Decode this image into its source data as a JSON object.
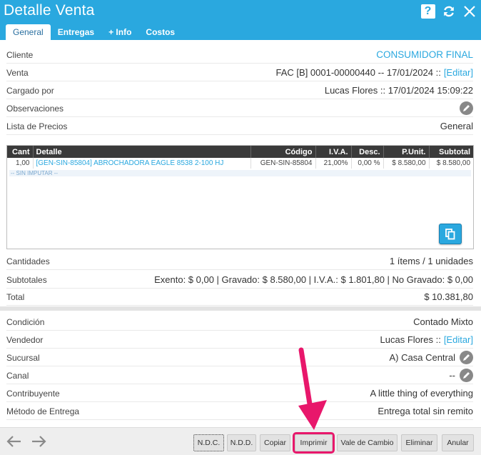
{
  "window": {
    "title": "Detalle Venta"
  },
  "tabs": [
    {
      "label": "General",
      "active": true
    },
    {
      "label": "Entregas",
      "active": false
    },
    {
      "label": "+ Info",
      "active": false
    },
    {
      "label": "Costos",
      "active": false
    }
  ],
  "fields": {
    "cliente": {
      "label": "Cliente",
      "value": "CONSUMIDOR FINAL"
    },
    "venta": {
      "label": "Venta",
      "value": "FAC [B] 0001-00000440 -- 17/01/2024 ::",
      "link": "[Editar]"
    },
    "cargado": {
      "label": "Cargado por",
      "value": "Lucas Flores :: 17/01/2024 15:09:22"
    },
    "observaciones": {
      "label": "Observaciones"
    },
    "lista": {
      "label": "Lista de Precios",
      "value": "General"
    }
  },
  "table": {
    "headers": [
      "Cant",
      "Detalle",
      "Código",
      "I.V.A.",
      "Desc.",
      "P.Unit.",
      "Subtotal"
    ],
    "rows": [
      {
        "cant": "1,00",
        "detalle": "[GEN-SIN-85804] ABROCHADORA EAGLE 8538 2-100 HJ",
        "codigo": "GEN-SIN-85804",
        "iva": "21,00%",
        "desc": "0,00 %",
        "punit": "$ 8.580,00",
        "subtotal": "$ 8.580,00"
      }
    ],
    "sin_imputar": "-- SIN IMPUTAR --"
  },
  "totals": {
    "cantidades": {
      "label": "Cantidades",
      "value": "1 ítems / 1 unidades"
    },
    "subtotales": {
      "label": "Subtotales",
      "value": "Exento: $ 0,00 | Gravado: $ 8.580,00 | I.V.A.: $ 1.801,80 | No Gravado: $ 0,00"
    },
    "total": {
      "label": "Total",
      "value": "$ 10.381,80"
    }
  },
  "details": {
    "condicion": {
      "label": "Condición",
      "value": "Contado Mixto"
    },
    "vendedor": {
      "label": "Vendedor",
      "value": "Lucas Flores ::",
      "link": "[Editar]"
    },
    "sucursal": {
      "label": "Sucursal",
      "value": "A) Casa Central"
    },
    "canal": {
      "label": "Canal",
      "value": "--"
    },
    "contribuyente": {
      "label": "Contribuyente",
      "value": "A little thing of everything"
    },
    "metodo": {
      "label": "Método de Entrega",
      "value": "Entrega total sin remito"
    }
  },
  "buttons": {
    "ndc": "N.D.C.",
    "ndd": "N.D.D.",
    "copiar": "Copiar",
    "imprimir": "Imprimir",
    "vale": "Vale de Cambio",
    "eliminar": "Eliminar",
    "anular": "Anular"
  },
  "colors": {
    "accent": "#2aa8df",
    "highlight": "#e8176b"
  },
  "icons": [
    "help-icon",
    "refresh-icon",
    "close-icon",
    "pencil-icon",
    "copy-icon",
    "arrow-left-icon",
    "arrow-right-icon"
  ]
}
